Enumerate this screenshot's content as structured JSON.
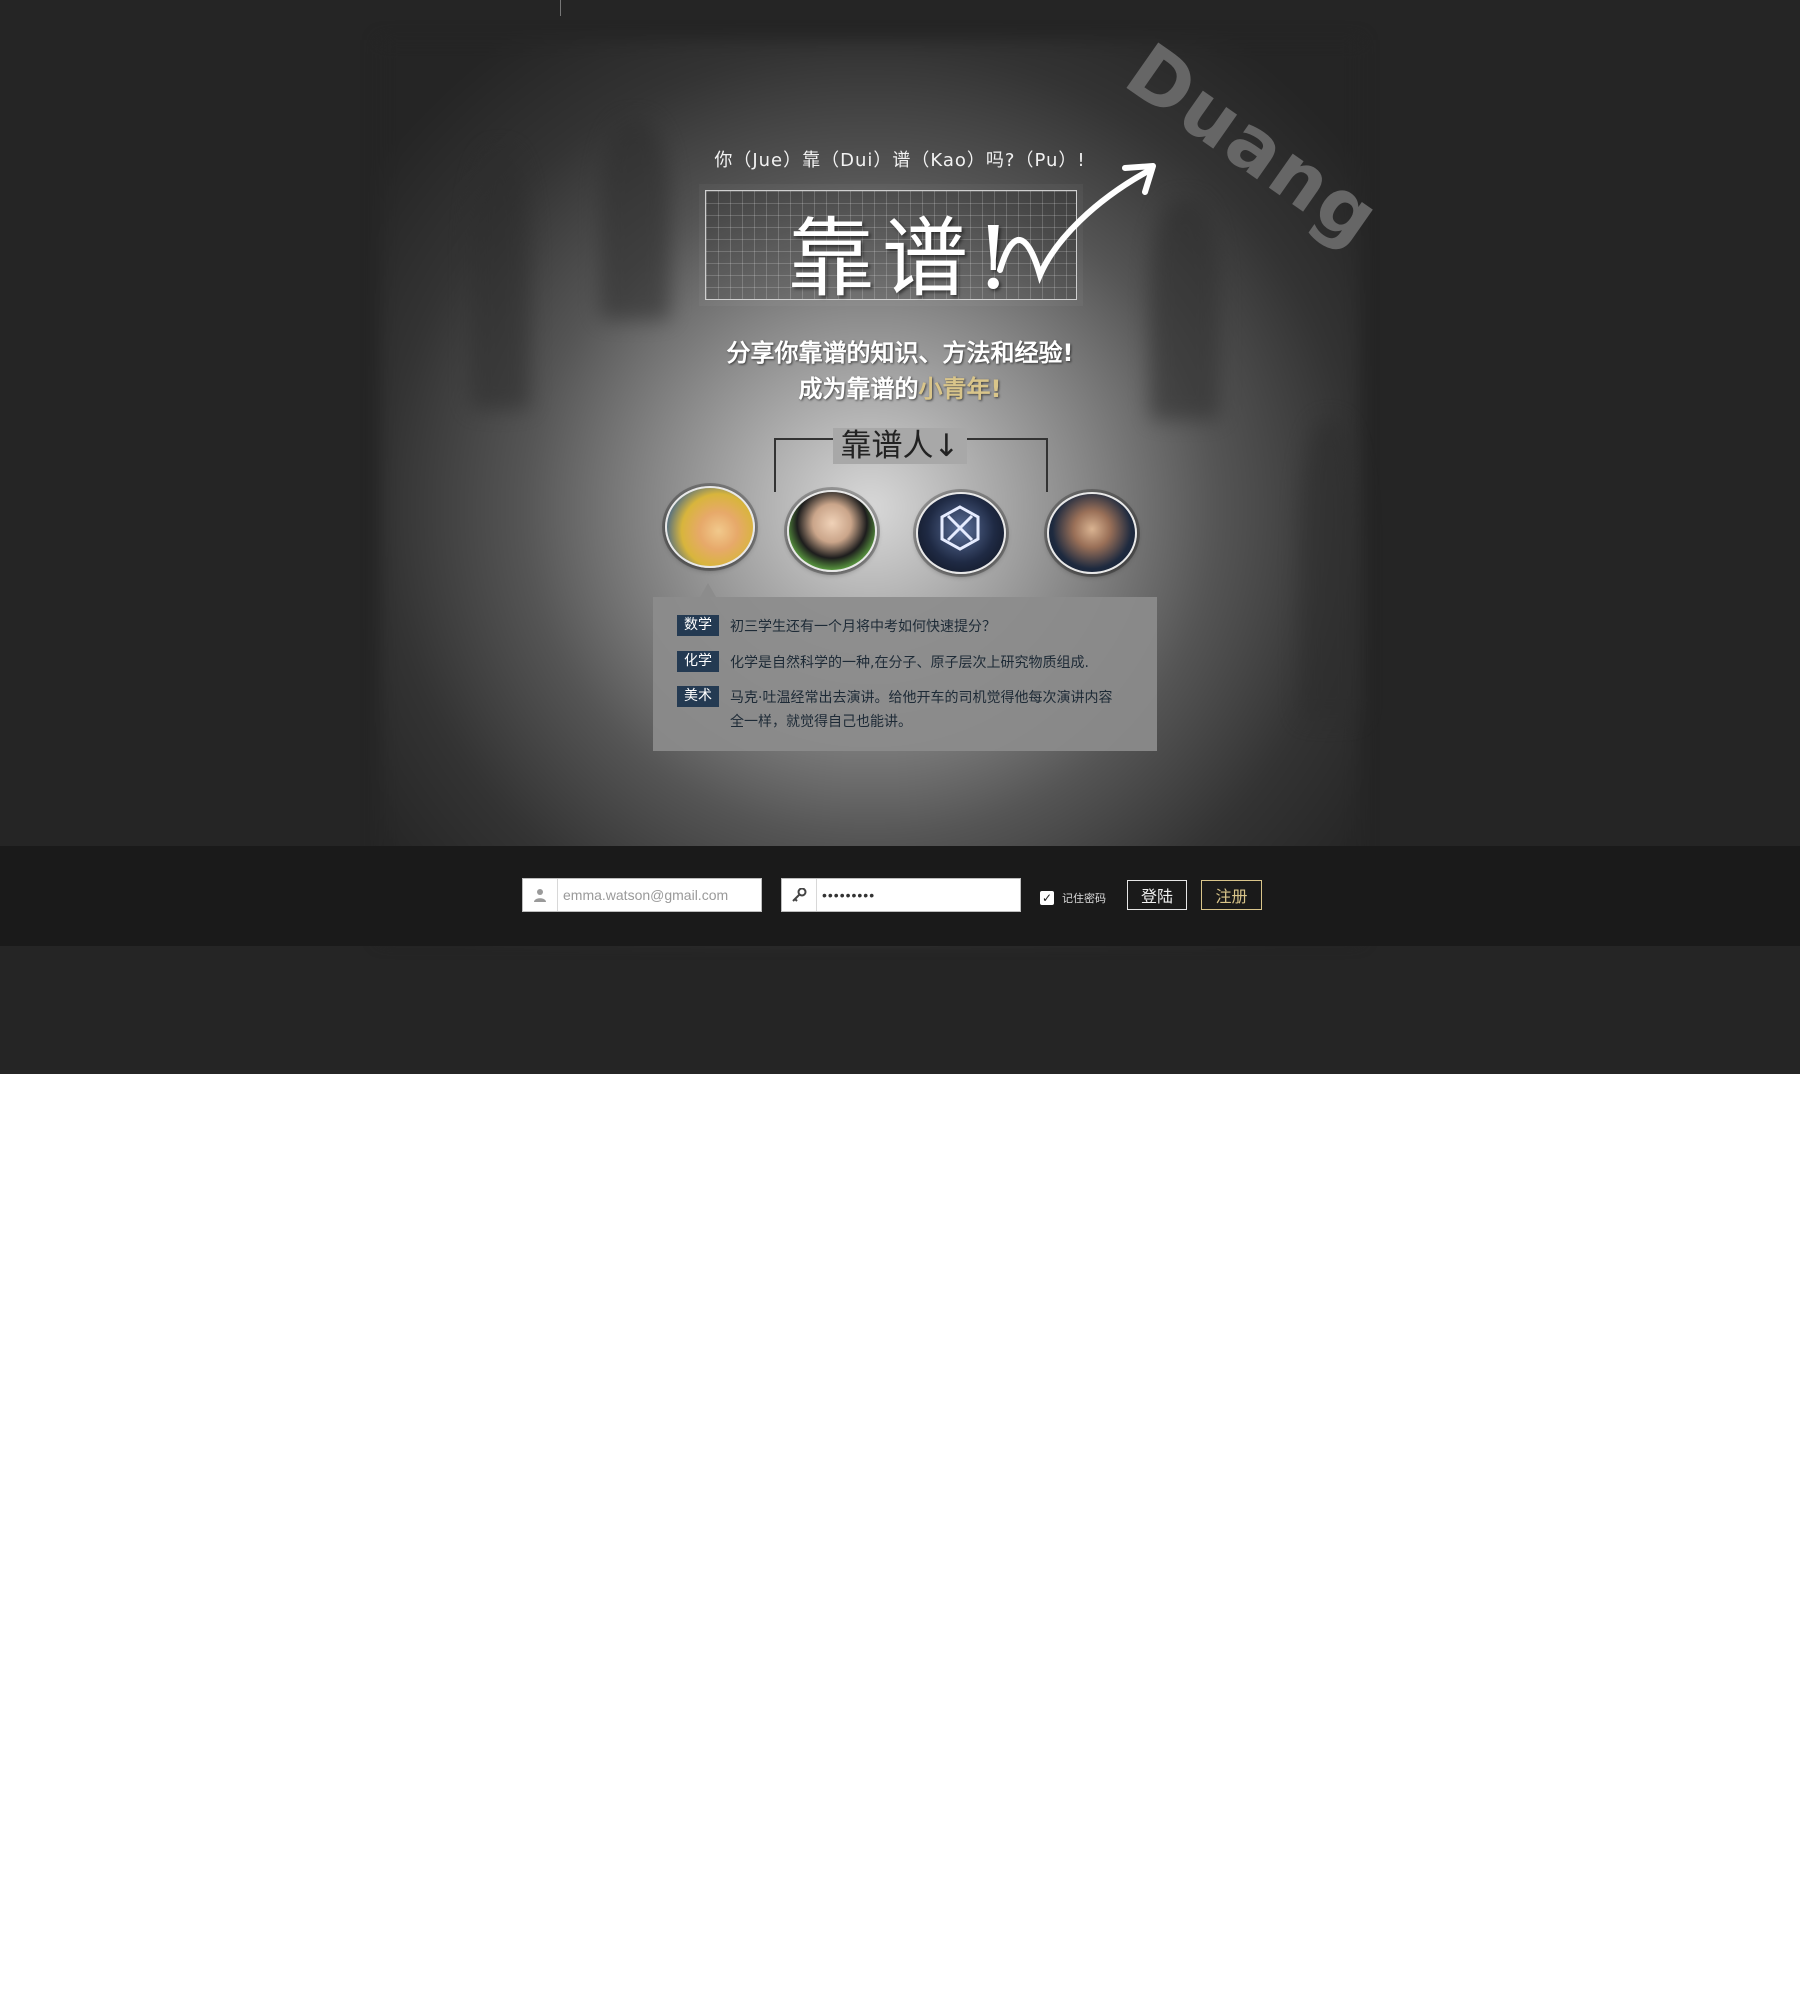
{
  "header": {
    "watermark": "Duang",
    "subtitle": "你（Jue）靠（Dui）谱（Kao）吗?（Pu）!",
    "title": "靠谱!"
  },
  "slogan": {
    "line1": "分享你靠谱的知识、方法和经验!",
    "line2_prefix": "成为靠谱的",
    "line2_highlight": "小青年!"
  },
  "people": {
    "label": "靠谱人↓",
    "avatars": [
      "avatar-1",
      "avatar-2",
      "avatar-3",
      "avatar-4"
    ]
  },
  "panel": {
    "items": [
      {
        "tag": "数学",
        "text": "初三学生还有一个月将中考如何快速提分？"
      },
      {
        "tag": "化学",
        "text": "化学是自然科学的一种,在分子、原子层次上研究物质组成."
      },
      {
        "tag": "美术",
        "text": "马克·吐温经常出去演讲。给他开车的司机觉得他每次演讲内容全一样，就觉得自己也能讲。"
      }
    ]
  },
  "login": {
    "email_placeholder": "emma.watson@gmail.com",
    "password_value": "•••••••••",
    "remember_label": "记住密码",
    "login_label": "登陆",
    "register_label": "注册",
    "user_icon": "user-icon",
    "key_icon": "key-icon"
  },
  "colors": {
    "background": "#252525",
    "accent_gold": "#d9c58a",
    "tag_bg": "#243a52",
    "login_bar": "#1a1a1a"
  }
}
